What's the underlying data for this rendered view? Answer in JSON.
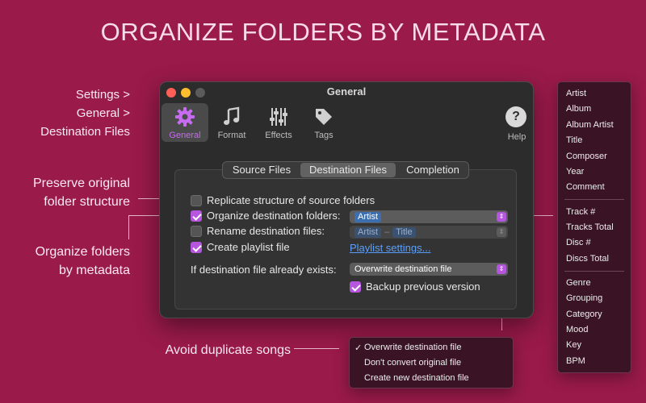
{
  "headline": "ORGANIZE FOLDERS BY METADATA",
  "annotations": {
    "path": [
      "Settings >",
      "General >",
      "Destination Files"
    ],
    "preserve": [
      "Preserve original",
      "folder structure"
    ],
    "organize": [
      "Organize folders",
      "by metadata"
    ],
    "duplicate": "Avoid duplicate songs"
  },
  "window": {
    "title": "General",
    "toolbar": [
      {
        "label": "General",
        "icon": "gear-icon"
      },
      {
        "label": "Format",
        "icon": "music-note-icon"
      },
      {
        "label": "Effects",
        "icon": "sliders-icon"
      },
      {
        "label": "Tags",
        "icon": "tag-icon"
      }
    ],
    "help": {
      "symbol": "?",
      "label": "Help"
    },
    "tabs": [
      "Source Files",
      "Destination Files",
      "Completion"
    ],
    "active_tab": "Destination Files",
    "options": {
      "replicate": {
        "label": "Replicate structure of source folders",
        "checked": false
      },
      "organize": {
        "label": "Organize destination folders:",
        "checked": true,
        "tokens": [
          "Artist"
        ]
      },
      "rename": {
        "label": "Rename destination files:",
        "checked": false,
        "tokens": [
          "Artist",
          "Title"
        ],
        "separator": "–"
      },
      "playlist": {
        "label": "Create playlist file",
        "checked": true,
        "link": "Playlist settings..."
      },
      "exists": {
        "label": "If destination file already exists:",
        "value": "Overwrite destination file"
      },
      "backup": {
        "label": "Backup previous version",
        "checked": true
      }
    }
  },
  "meta_menu": {
    "group1": [
      "Artist",
      "Album",
      "Album Artist",
      "Title",
      "Composer",
      "Year",
      "Comment"
    ],
    "group2": [
      "Track #",
      "Tracks Total",
      "Disc #",
      "Discs Total"
    ],
    "group3": [
      "Genre",
      "Grouping",
      "Category",
      "Mood",
      "Key",
      "BPM"
    ]
  },
  "dup_menu": {
    "items": [
      "Overwrite destination file",
      "Don't convert original file",
      "Create new destination file"
    ],
    "checked_mark": "✓"
  },
  "colors": {
    "background": "#9a1a4a",
    "accent": "#b655de",
    "link": "#5aa0ff",
    "token": "#3d6fb0"
  }
}
